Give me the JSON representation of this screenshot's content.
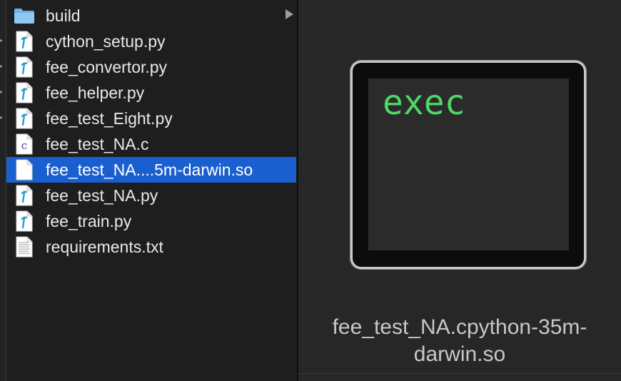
{
  "files": [
    {
      "name": "build",
      "icon": "folder-icon",
      "kind": "folder",
      "has_children": true
    },
    {
      "name": "cython_setup.py",
      "icon": "python-file-icon",
      "kind": "py"
    },
    {
      "name": "fee_convertor.py",
      "icon": "python-file-icon",
      "kind": "py"
    },
    {
      "name": "fee_helper.py",
      "icon": "python-file-icon",
      "kind": "py"
    },
    {
      "name": "fee_test_Eight.py",
      "icon": "python-file-icon",
      "kind": "py"
    },
    {
      "name": "fee_test_NA.c",
      "icon": "c-file-icon",
      "kind": "c"
    },
    {
      "name": "fee_test_NA....5m-darwin.so",
      "icon": "blank-file-icon",
      "kind": "so",
      "selected": true
    },
    {
      "name": "fee_test_NA.py",
      "icon": "python-file-icon",
      "kind": "py"
    },
    {
      "name": "fee_train.py",
      "icon": "python-file-icon",
      "kind": "py"
    },
    {
      "name": "requirements.txt",
      "icon": "text-file-icon",
      "kind": "txt"
    }
  ],
  "preview": {
    "icon_label": "exec",
    "icon_name": "unix-executable-icon",
    "filename": "fee_test_NA.cpython-35m-darwin.so"
  },
  "colors": {
    "selection": "#1a5fd0",
    "exec_text": "#4cd964",
    "folder": "#6fb3e6"
  }
}
